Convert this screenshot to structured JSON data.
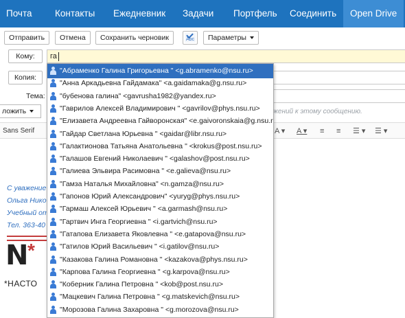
{
  "nav": {
    "tabs": [
      "Почта",
      "Контакты",
      "Ежедневник",
      "Задачи",
      "Портфель",
      "Соединить",
      "Open Drive"
    ],
    "active_index": 6
  },
  "toolbar": {
    "send": "Отправить",
    "cancel": "Отмена",
    "save_draft": "Сохранить черновик",
    "spell_icon_text": "Abc",
    "params": "Параметры"
  },
  "compose": {
    "to_label": "Кому:",
    "to_value": "га",
    "cc_label": "Копия:",
    "subject_label": "Тема:",
    "attach": "ложить",
    "hint": "жений к этому сообщению."
  },
  "editor": {
    "font": "Sans Serif"
  },
  "signature": {
    "line1": "С уважение",
    "line2": "Ольга Нико",
    "line3": "Учебный от",
    "line4": "Тел. 363-40",
    "logo_letter": "N",
    "logo_star": "*",
    "logo_text": "*НАСТО"
  },
  "autocomplete": {
    "selected_index": 0,
    "items": [
      "\"Абраменко Галина Григорьевна \" <g.abramenko@nsu.ru>",
      "\"Анна Аркадьевна Гайдамака\" <a.gaidamaka@g.nsu.ru>",
      "\"бубенова галина\" <gavrusha1982@yandex.ru>",
      "\"Гаврилов Алексей Владимирович \" <gavrilov@phys.nsu.ru>",
      "\"Елизавета Андреевна Гайворонская\" <e.gaivoronskaia@g.nsu.ru>",
      "\"Гайдар Светлана Юрьевна \" <gaidar@libr.nsu.ru>",
      "\"Галактионова Татьяна Анатольевна \" <krokus@post.nsu.ru>",
      "\"Галашов Евгений Николаевич \" <galashov@post.nsu.ru>",
      "\"Галиева Эльвира Расимовна \" <e.galieva@nsu.ru>",
      "\"Гамза Наталья Михайловна\" <n.gamza@nsu.ru>",
      "\"Гапонов Юрий Александрович\" <yuryg@phys.nsu.ru>",
      "\"Гармаш Алексей Юрьевич \" <a.garmash@nsu.ru>",
      "\"Гартвич Инга Георгиевна \" <i.gartvich@nsu.ru>",
      "\"Гатапова Елизавета Яковлевна \" <e.gatapova@nsu.ru>",
      "\"Гатилов Юрий Васильевич \" <i.gatilov@nsu.ru>",
      "\"Казакова Галина Романовна \" <kazakova@phys.nsu.ru>",
      "\"Карпова Галина Георгиевна \" <g.karpova@nsu.ru>",
      "\"Коберник Галина Петровна \" <kob@post.nsu.ru>",
      "\"Мацкевич Галина Петровна \" <g.matskevich@nsu.ru>",
      "\"Морозова Галина Захаровна \" <g.morozova@nsu.ru>"
    ]
  },
  "colors": {
    "nav_bg": "#1e73be",
    "nav_active": "#3d8dd4",
    "selection": "#2f6fbf",
    "to_field_bg": "#fff9d6",
    "signature_text": "#2f6fbf",
    "logo_red": "#c43b3b"
  }
}
